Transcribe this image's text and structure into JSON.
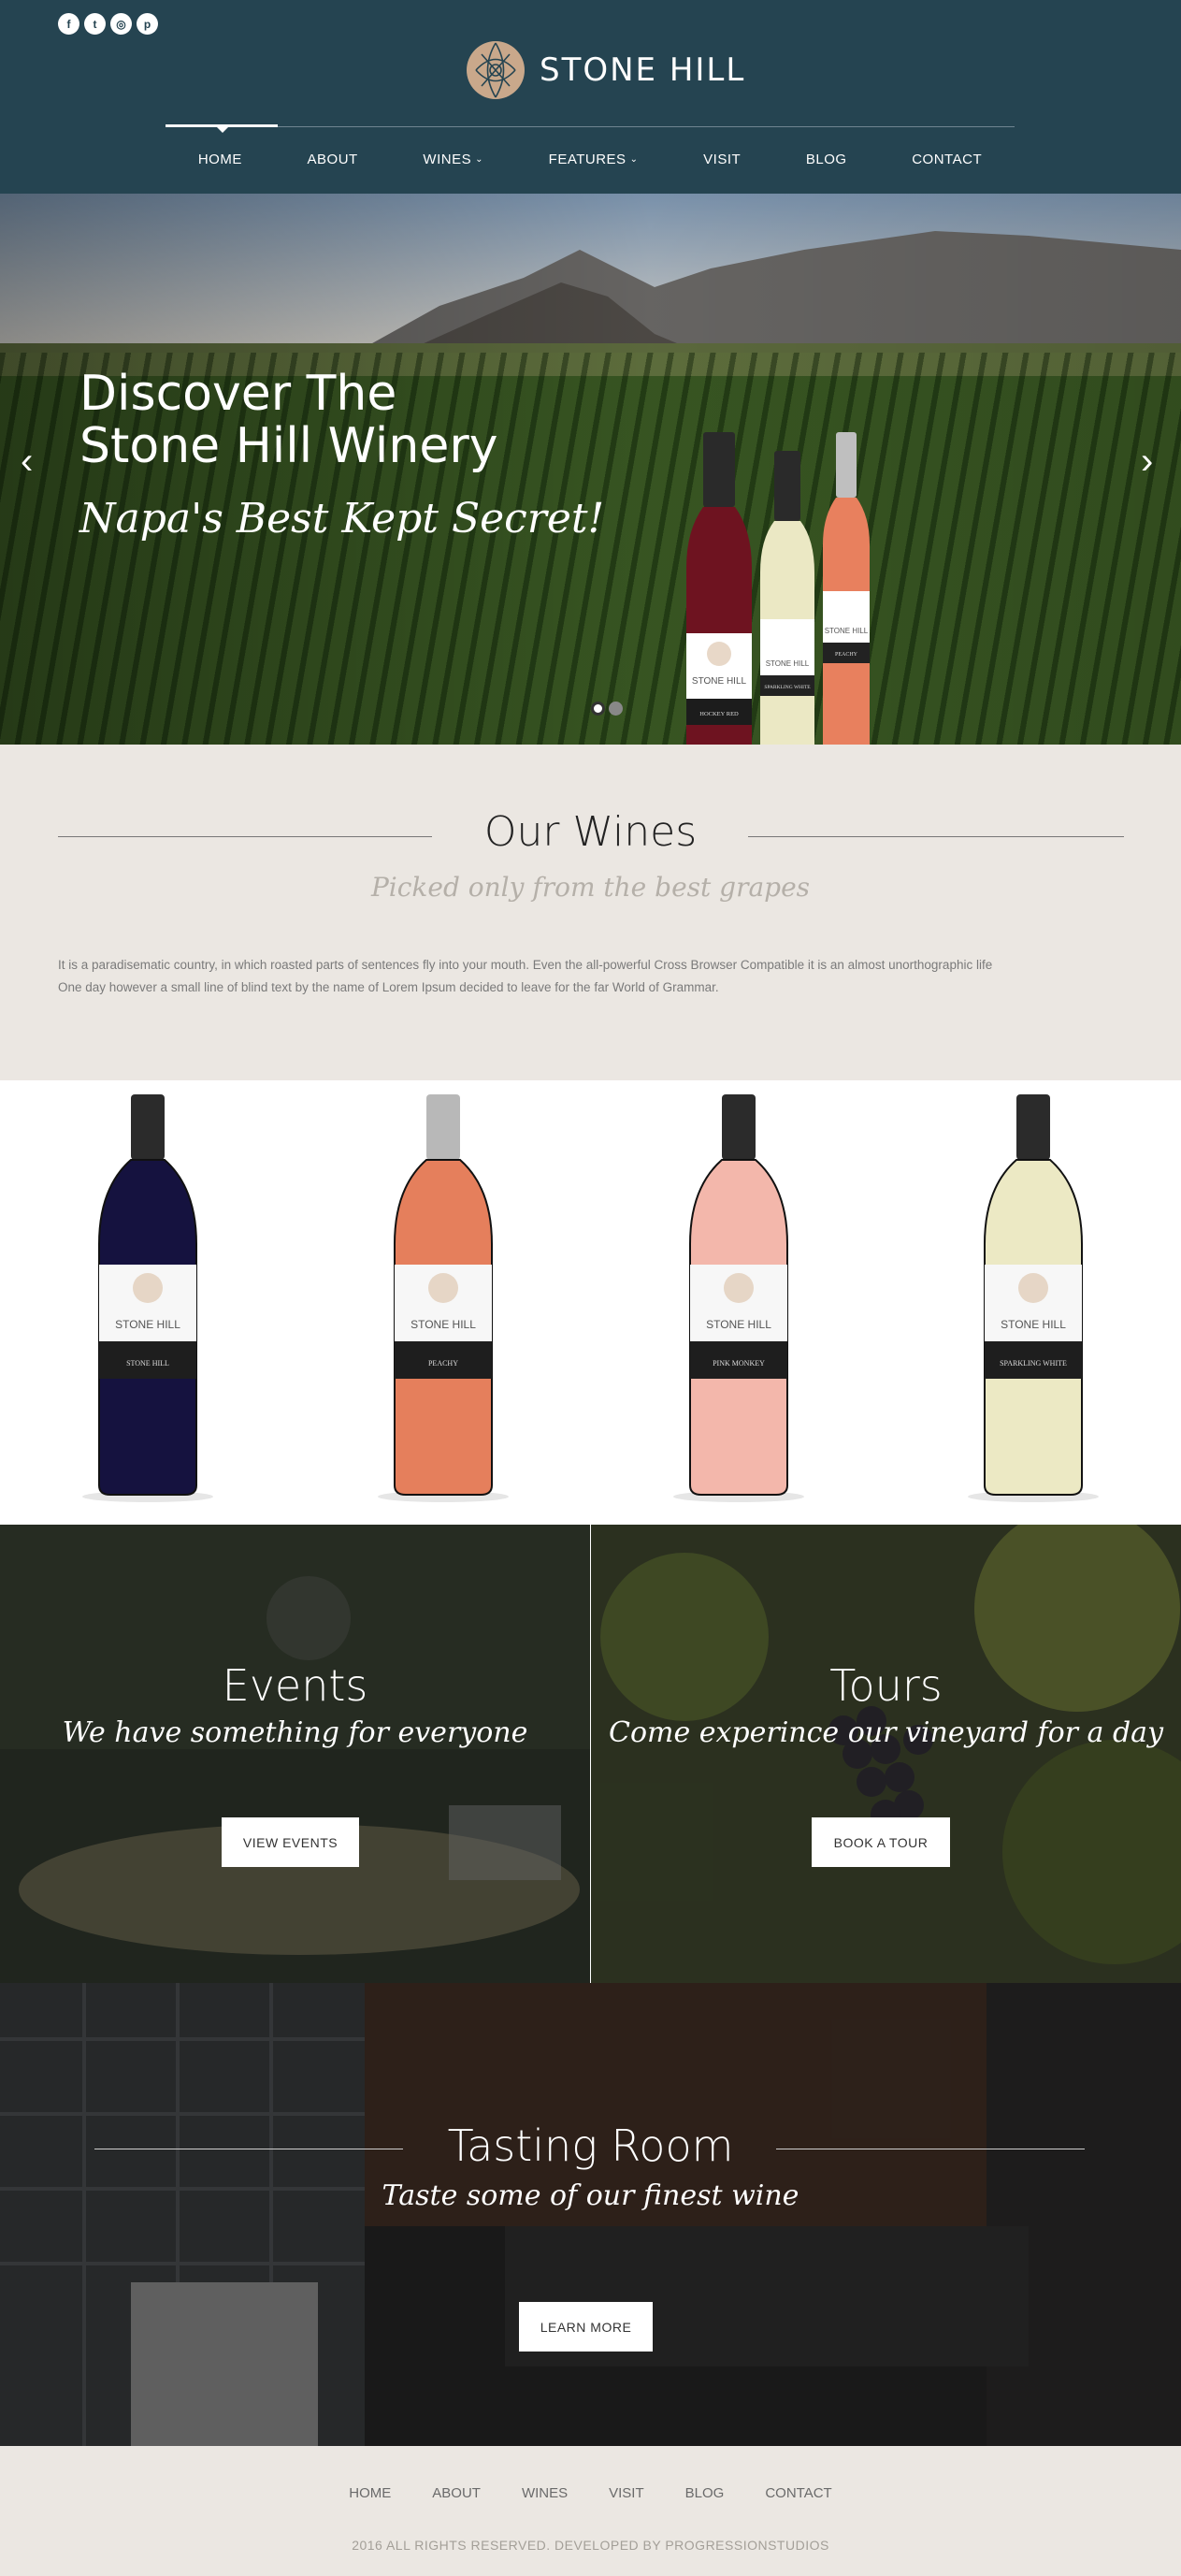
{
  "header": {
    "brand_name": "STONE HILL",
    "socials": [
      {
        "icon": "facebook-icon",
        "glyph": "f"
      },
      {
        "icon": "twitter-icon",
        "glyph": "t"
      },
      {
        "icon": "instagram-icon",
        "glyph": "◎"
      },
      {
        "icon": "pinterest-icon",
        "glyph": "p"
      }
    ],
    "nav": [
      {
        "label": "HOME",
        "active": true
      },
      {
        "label": "ABOUT"
      },
      {
        "label": "WINES",
        "dropdown": true
      },
      {
        "label": "FEATURES",
        "dropdown": true
      },
      {
        "label": "VISIT"
      },
      {
        "label": "BLOG"
      },
      {
        "label": "CONTACT"
      }
    ],
    "chevron": "⌄"
  },
  "hero": {
    "title_line1": "Discover The",
    "title_line2": "Stone Hill Winery",
    "script": "Napa's Best Kept Secret!",
    "prev_arrow": "‹",
    "next_arrow": "›",
    "slide_count": 2,
    "active_slide": 1,
    "bottle_labels": [
      "STONE HILL",
      "STONE HILL",
      "STONE HILL"
    ],
    "bottle_sublabels": [
      "HOCKEY RED",
      "SPARKLING WHITE",
      "PEACHY"
    ]
  },
  "our_wines": {
    "title": "Our Wines",
    "subtitle": "Picked only from the best grapes",
    "body_line1": "It is a paradisematic country, in which roasted parts of sentences fly into your mouth. Even the all-powerful Cross Browser Compatible it is an almost unorthographic life",
    "body_line2": "One day however a small line of blind text by the name of Lorem Ipsum decided to leave for the far World of Grammar."
  },
  "bottles": [
    {
      "brand": "STONE HILL",
      "name": "STONE HILL",
      "color": "#15123f",
      "cap": "#2b2b2b"
    },
    {
      "brand": "STONE HILL",
      "name": "PEACHY",
      "color": "#e57f5c",
      "cap": "#b8b8b8"
    },
    {
      "brand": "STONE HILL",
      "name": "PINK MONKEY",
      "color": "#f3b7ab",
      "cap": "#2b2b2b"
    },
    {
      "brand": "STONE HILL",
      "name": "SPARKLING WHITE",
      "color": "#ece9c4",
      "cap": "#2b2b2b"
    }
  ],
  "events": {
    "title": "Events",
    "script": "We have something for everyone",
    "button": "VIEW EVENTS"
  },
  "tours": {
    "title": "Tours",
    "script": "Come experince our vineyard for a day",
    "button": "BOOK A TOUR"
  },
  "tasting": {
    "title": "Tasting Room",
    "script": "Taste some of our finest wine",
    "button": "LEARN MORE"
  },
  "footer": {
    "links": [
      "HOME",
      "ABOUT",
      "WINES",
      "VISIT",
      "BLOG",
      "CONTACT"
    ],
    "copyright": "2016 ALL RIGHTS RESERVED. DEVELOPED BY PROGRESSIONSTUDIOS"
  },
  "colors": {
    "header_bg": "#254451",
    "section_bg": "#ebe7e2",
    "accent_logo": "#c9a88b"
  }
}
